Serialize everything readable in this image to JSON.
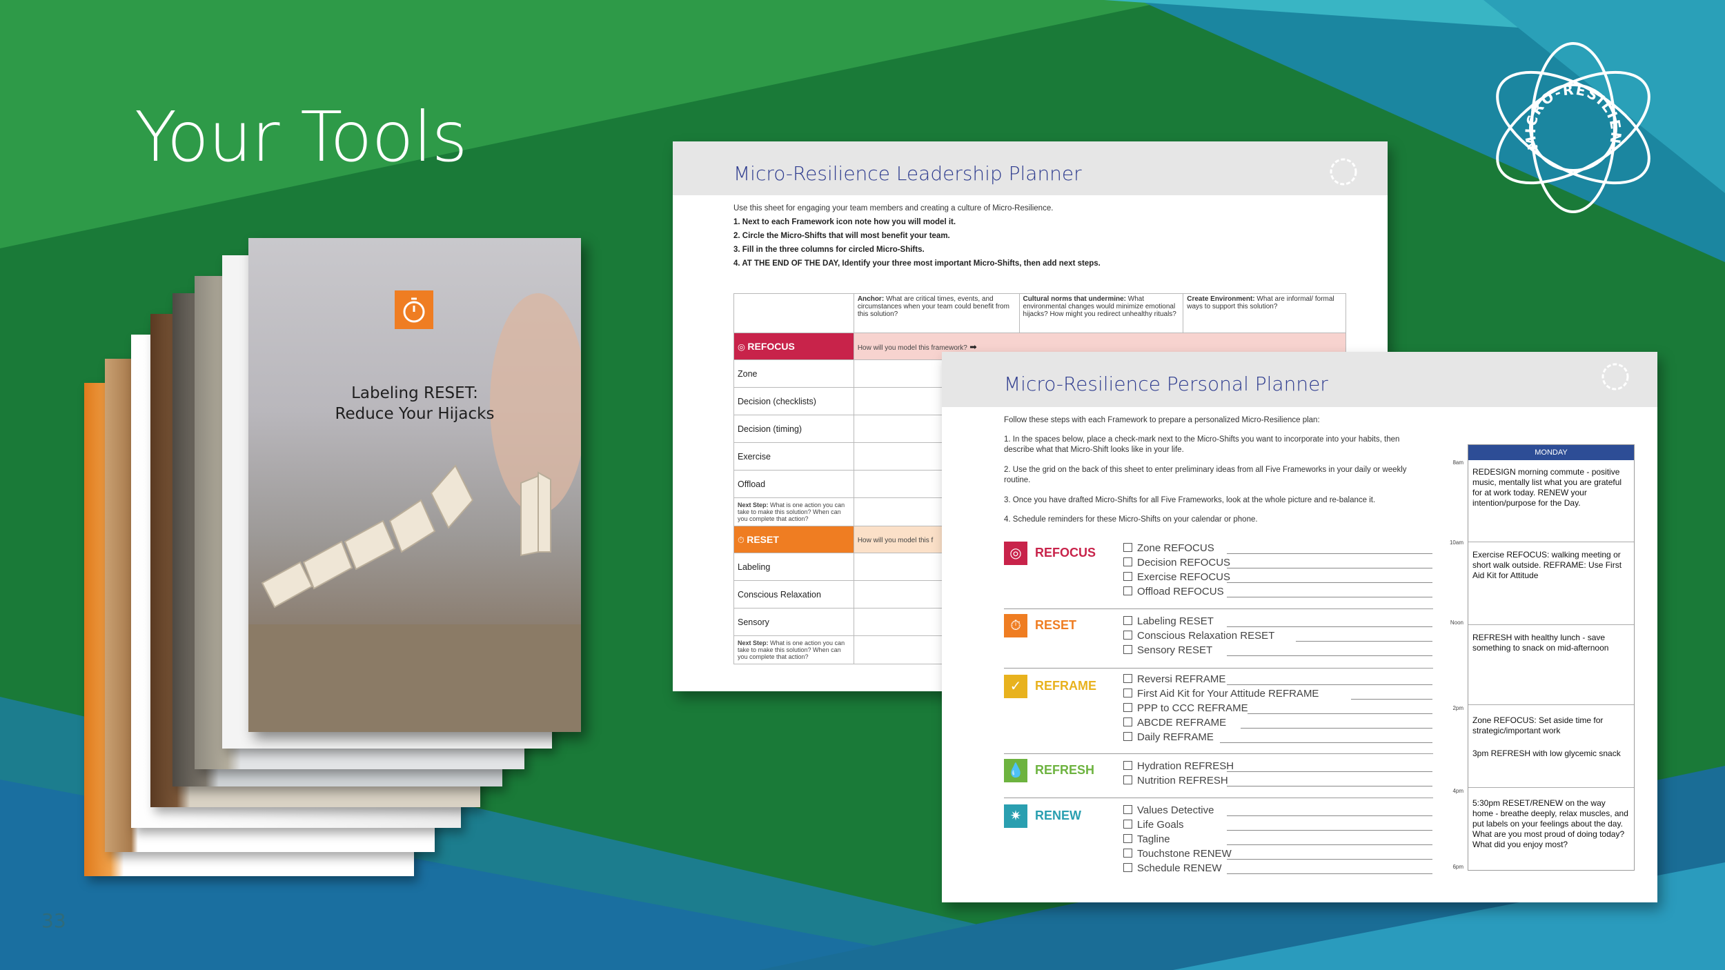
{
  "slide": {
    "title": "Your Tools",
    "number": "33"
  },
  "logo": {
    "text": "MICRO-RESILIENCE"
  },
  "cover": {
    "title_line1": "Labeling RESET:",
    "title_line2": "Reduce Your Hijacks",
    "icon": "stopwatch-icon"
  },
  "leadership": {
    "title": "Micro-Resilience Leadership Planner",
    "intro": "Use this sheet for engaging your team members and creating a culture of Micro-Resilience.",
    "steps": [
      "1. Next to each Framework icon note how you will model it.",
      "2. Circle the Micro-Shifts that will most benefit your team.",
      "3. Fill in the three columns for circled Micro-Shifts.",
      "4. AT THE END OF THE DAY, Identify your three most important Micro-Shifts, then add next steps."
    ],
    "columns": [
      {
        "bold": "Anchor:",
        "text": " What are critical times, events, and circumstances when your team could benefit from this solution?"
      },
      {
        "bold": "Cultural norms that undermine:",
        "text": " What environmental changes would minimize emotional hijacks? How might you redirect unhealthy rituals?"
      },
      {
        "bold": "Create Environment:",
        "text": " What are informal/ formal ways to support this solution?"
      }
    ],
    "frameworks": [
      {
        "name": "REFOCUS",
        "question": "How will you model this framework?",
        "color": "#c8234a",
        "rows": [
          "Zone",
          "Decision (checklists)",
          "Decision (timing)",
          "Exercise",
          "Offload"
        ]
      },
      {
        "name": "RESET",
        "question": "How will you model this f",
        "color": "#ef7d22",
        "rows": [
          "Labeling",
          "Conscious Relaxation",
          "Sensory"
        ]
      }
    ],
    "next_step_bold": "Next Step:",
    "next_step": " What is one action you can take to make this solution? When can you complete that action?"
  },
  "personal": {
    "title": "Micro-Resilience Personal Planner",
    "intro": "Follow these steps with each Framework to prepare a personalized Micro-Resilience plan:",
    "steps": [
      "1. In the spaces below, place a check-mark next to the Micro-Shifts you want to incorporate into your habits, then describe what that Micro-Shift looks like in your life.",
      "2. Use the grid on the back of this sheet to enter preliminary ideas from all Five Frameworks in your daily or weekly routine.",
      "3. Once you have drafted Micro-Shifts for all Five Frameworks, look at the whole picture and re-balance it.",
      "4. Schedule reminders for these Micro-Shifts on your calendar or phone."
    ],
    "frameworks": [
      {
        "name": "REFOCUS",
        "color": "#c8234a",
        "icon": "target-icon",
        "items": [
          "Zone REFOCUS",
          "Decision REFOCUS",
          "Exercise REFOCUS",
          "Offload REFOCUS"
        ]
      },
      {
        "name": "RESET",
        "color": "#ef7d22",
        "icon": "stopwatch-icon",
        "items": [
          "Labeling RESET",
          "Conscious Relaxation RESET",
          "Sensory RESET"
        ]
      },
      {
        "name": "REFRAME",
        "color": "#e8b21e",
        "icon": "checkmark-icon",
        "items": [
          "Reversi REFRAME",
          "First Aid Kit for Your Attitude REFRAME",
          "PPP to CCC REFRAME",
          "ABCDE REFRAME",
          "Daily REFRAME"
        ]
      },
      {
        "name": "REFRESH",
        "color": "#6db33f",
        "icon": "water-drop-icon",
        "items": [
          "Hydration REFRESH",
          "Nutrition REFRESH"
        ]
      },
      {
        "name": "RENEW",
        "color": "#2a9fb0",
        "icon": "burst-icon",
        "items": [
          "Values Detective",
          "Life Goals",
          "Tagline",
          "Touchstone RENEW",
          "Schedule RENEW"
        ]
      }
    ],
    "day": "MONDAY",
    "times": [
      "8am",
      "10am",
      "Noon",
      "2pm",
      "4pm",
      "6pm"
    ],
    "entries": [
      "REDESIGN morning commute - positive music, mentally list what you are grateful for at work today. RENEW your intention/purpose for the Day.",
      "Exercise REFOCUS: walking meeting or short walk outside. REFRAME: Use First Aid Kit for Attitude",
      "REFRESH with healthy lunch - save something to snack on mid-afternoon",
      "Zone REFOCUS: Set aside time for strategic/important work",
      "3pm REFRESH with low glycemic snack",
      "5:30pm RESET/RENEW on the way home - breathe deeply, relax muscles, and put labels on your feelings about the day. What are you most proud of doing today? What did you enjoy most?"
    ]
  }
}
